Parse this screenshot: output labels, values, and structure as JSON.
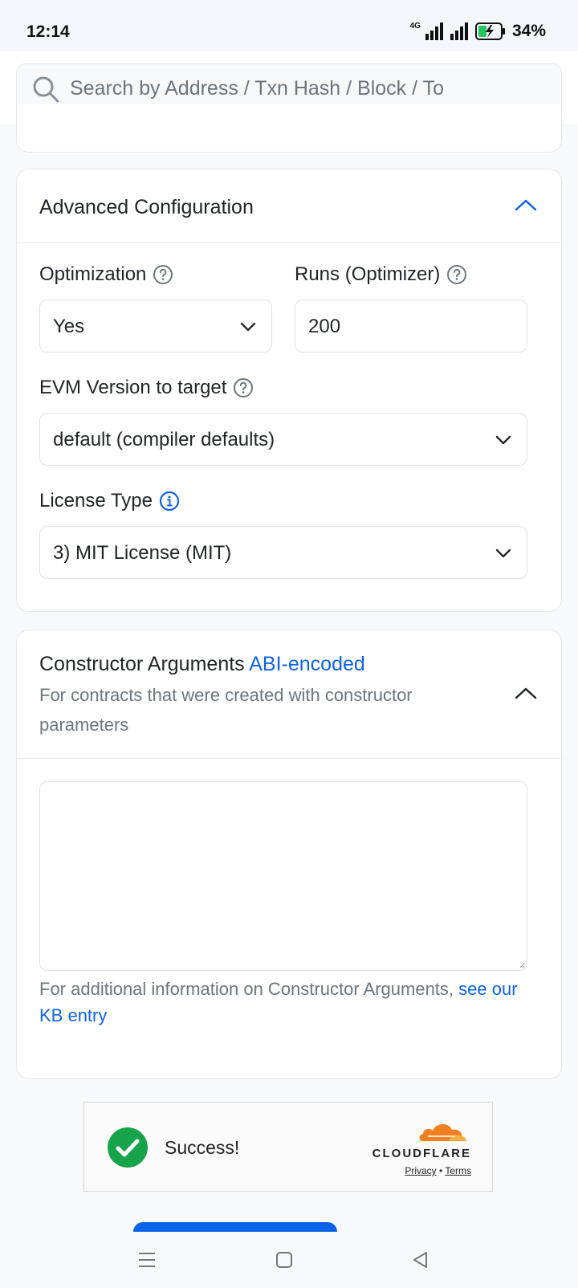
{
  "status_bar": {
    "time": "12:14",
    "network": "4G",
    "battery": "34%"
  },
  "search": {
    "placeholder": "Search by Address / Txn Hash / Block / To"
  },
  "advanced_config": {
    "title": "Advanced Configuration",
    "optimization": {
      "label": "Optimization",
      "value": "Yes"
    },
    "runs": {
      "label": "Runs (Optimizer)",
      "value": "200"
    },
    "evm_version": {
      "label": "EVM Version to target",
      "value": "default (compiler defaults)"
    },
    "license": {
      "label": "License Type",
      "value": "3) MIT License (MIT)"
    }
  },
  "constructor_args": {
    "title": "Constructor Arguments",
    "title_link": "ABI-encoded",
    "subtitle": "For contracts that were created with constructor parameters",
    "textarea_value": "",
    "note": "For additional information on Constructor Arguments, ",
    "note_link": "see our KB entry"
  },
  "captcha": {
    "status": "Success!",
    "brand": "CLOUDFLARE",
    "privacy": "Privacy",
    "separator": "•",
    "terms": "Terms"
  },
  "colors": {
    "accent": "#0d63e8",
    "success": "#16a34a",
    "cloudflare": "#f38020"
  },
  "icons": [
    "search-icon",
    "chevron-up-icon",
    "help-circle-icon",
    "info-circle-icon",
    "chevron-down-icon",
    "check-circle-icon",
    "cloudflare-logo",
    "menu-icon",
    "home-square-icon",
    "back-triangle-icon"
  ]
}
